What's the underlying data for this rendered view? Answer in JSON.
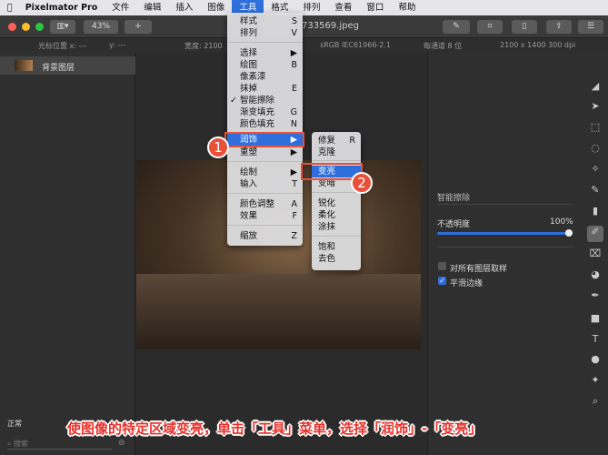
{
  "menubar": {
    "apple": "",
    "app": "Pixelmator Pro",
    "items": [
      "文件",
      "编辑",
      "插入",
      "图像",
      "工具",
      "格式",
      "排列",
      "查看",
      "窗口",
      "帮助"
    ]
  },
  "toolbar": {
    "zoom": "43%",
    "add": "+",
    "filename": "733569.jpeg"
  },
  "info": {
    "cursor_x": "光标位置 x: ---",
    "cursor_y": "y: ---",
    "width": "宽度: 2100",
    "color": "sRGB IEC61966-2.1",
    "depth": "每通道 8 位",
    "size": "2100 x 1400 300 dpi"
  },
  "layers": {
    "layer_name": "背景图层",
    "blend": "正常",
    "search_placeholder": "搜索"
  },
  "tools_menu": {
    "items": [
      {
        "label": "样式",
        "shortcut": "S"
      },
      {
        "label": "排列",
        "shortcut": "V"
      },
      {
        "label": "选择",
        "shortcut": "▶"
      },
      {
        "label": "绘图",
        "shortcut": "B"
      },
      {
        "label": "像素漆",
        "shortcut": ""
      },
      {
        "label": "抹掉",
        "shortcut": "E"
      },
      {
        "label": "智能擦除",
        "shortcut": "",
        "checked": true
      },
      {
        "label": "渐变填充",
        "shortcut": "G"
      },
      {
        "label": "颜色填充",
        "shortcut": "N"
      },
      {
        "label": "润饰",
        "shortcut": "▶",
        "highlighted": true
      },
      {
        "label": "重塑",
        "shortcut": "▶"
      },
      {
        "label": "绘制",
        "shortcut": "▶"
      },
      {
        "label": "输入",
        "shortcut": "T"
      },
      {
        "label": "颜色调整",
        "shortcut": "A"
      },
      {
        "label": "效果",
        "shortcut": "F"
      },
      {
        "label": "缩放",
        "shortcut": "Z"
      }
    ]
  },
  "retouch_menu": {
    "items": [
      {
        "label": "修复",
        "shortcut": "R"
      },
      {
        "label": "克隆",
        "shortcut": ""
      },
      {
        "label": "变亮",
        "highlighted": true
      },
      {
        "label": "变暗"
      },
      {
        "label": "锐化"
      },
      {
        "label": "柔化"
      },
      {
        "label": "涂抹"
      },
      {
        "label": "饱和"
      },
      {
        "label": "去色"
      }
    ]
  },
  "panel": {
    "title": "智能擦除",
    "opacity_label": "不透明度",
    "opacity_value": "100%",
    "opacity": 100,
    "sample_all": "对所有图层取样",
    "sample_all_checked": false,
    "smooth": "平滑边缘",
    "smooth_checked": true
  },
  "callouts": [
    "1",
    "2"
  ],
  "caption": "使图像的特定区域变亮，单击「工具」菜单，选择「润饰」-「变亮」",
  "colors": {
    "accent": "#2f6fdc",
    "callout": "#e8503a"
  }
}
